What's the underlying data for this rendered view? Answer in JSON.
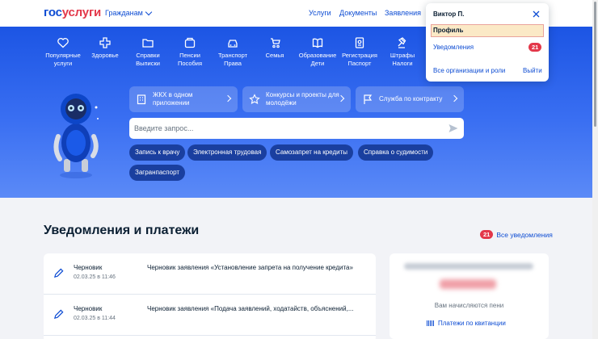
{
  "header": {
    "logo_part1": "гос",
    "logo_part2": "услуги",
    "role": "Гражданам",
    "nav": [
      "Услуги",
      "Документы",
      "Заявления"
    ]
  },
  "categories": [
    {
      "label": "Популярные услуги",
      "icon": "heart-icon"
    },
    {
      "label": "Здоровье",
      "icon": "medical-cross-icon"
    },
    {
      "label": "Справки Выписки",
      "icon": "folder-icon"
    },
    {
      "label": "Пенсии Пособия",
      "icon": "wallet-icon"
    },
    {
      "label": "Транспорт Права",
      "icon": "car-icon"
    },
    {
      "label": "Семья",
      "icon": "stroller-icon"
    },
    {
      "label": "Образование Дети",
      "icon": "book-icon"
    },
    {
      "label": "Регистрация Паспорт",
      "icon": "passport-icon"
    },
    {
      "label": "Штрафы Налоги",
      "icon": "gavel-icon"
    }
  ],
  "promos": [
    {
      "label": "ЖКХ в одном приложении",
      "icon": "building-icon"
    },
    {
      "label": "Конкурсы и проекты для молодёжи",
      "icon": "star-icon"
    },
    {
      "label": "Служба по контракту",
      "icon": "flag-icon"
    }
  ],
  "search": {
    "placeholder": "Введите запрос..."
  },
  "chips": [
    "Запись к врачу",
    "Электронная трудовая",
    "Самозапрет на кредиты",
    "Справка о судимости",
    "Загранпаспорт"
  ],
  "notifications": {
    "title": "Уведомления и платежи",
    "count": "21",
    "all_link": "Все уведомления",
    "items": [
      {
        "status": "Черновик",
        "date": "02.03.25 в 11:46",
        "text": "Черновик заявления «Установление запрета на получение кредита»"
      },
      {
        "status": "Черновик",
        "date": "02.03.25 в 11:44",
        "text": "Черновик заявления «Подача заявлений, ходатайств, объяснений,..."
      }
    ]
  },
  "payments": {
    "note": "Вам начисляются пени",
    "link": "Платежи по квитанции"
  },
  "profile_menu": {
    "name": "Виктор П.",
    "profile": "Профиль",
    "notifications": "Уведомления",
    "notifications_count": "21",
    "orgs": "Все организации и роли",
    "logout": "Выйти"
  },
  "colors": {
    "brand_blue": "#0d4cd3",
    "brand_red": "#e3384a",
    "hero": "#2a62ec"
  }
}
